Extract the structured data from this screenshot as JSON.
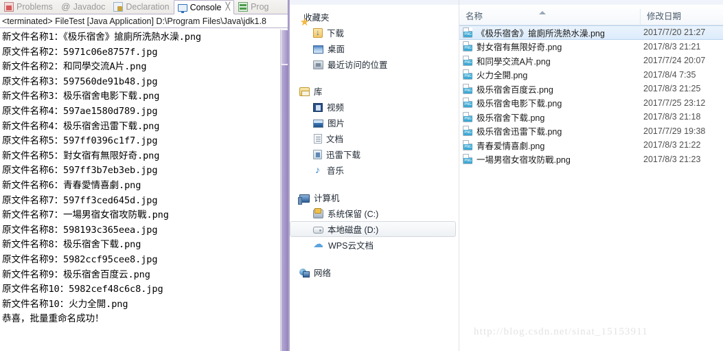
{
  "eclipse": {
    "tabs": [
      {
        "label": "Problems",
        "icon": "problems-icon",
        "active": false
      },
      {
        "label": "Javadoc",
        "icon": "javadoc-icon",
        "active": false
      },
      {
        "label": "Declaration",
        "icon": "declaration-icon",
        "active": false
      },
      {
        "label": "Console",
        "icon": "console-icon",
        "active": true,
        "close_glyph": "╳"
      },
      {
        "label": "Prog",
        "icon": "progress-icon",
        "active": false
      }
    ],
    "launch_line": "<terminated> FileTest [Java Application] D:\\Program Files\\Java\\jdk1.8",
    "console_lines": [
      "新文件名称1：《极乐宿舍》搶廁所洗熱水澡.png",
      "原文件名称2：5971c06e8757f.jpg",
      "新文件名称2：和同學交流A片.png",
      "原文件名称3：597560de91b48.jpg",
      "新文件名称3：极乐宿舍电影下载.png",
      "原文件名称4：597ae1580d789.jpg",
      "新文件名称4：极乐宿舍迅雷下载.png",
      "原文件名称5：597ff0396c1f7.jpg",
      "新文件名称5：對女宿有無限好奇.png",
      "原文件名称6：597ff3b7eb3eb.jpg",
      "新文件名称6：青春愛情喜劇.png",
      "原文件名称7：597ff3ced645d.jpg",
      "新文件名称7：一場男宿女宿攻防戰.png",
      "原文件名称8：598193c365eea.jpg",
      "新文件名称8：极乐宿舍下载.png",
      "原文件名称9：5982ccf95cee8.jpg",
      "新文件名称9：极乐宿舍百度云.png",
      "原文件名称10：5982cef48c6c8.jpg",
      "新文件名称10：火力全開.png",
      "恭喜，批量重命名成功！"
    ]
  },
  "explorer": {
    "nav": {
      "groups": [
        {
          "root": {
            "label": "收藏夹",
            "icon": "favorites-star-icon"
          },
          "items": [
            {
              "label": "下载",
              "icon": "downloads-icon"
            },
            {
              "label": "桌面",
              "icon": "desktop-icon"
            },
            {
              "label": "最近访问的位置",
              "icon": "recent-places-icon"
            }
          ]
        },
        {
          "root": {
            "label": "库",
            "icon": "library-icon"
          },
          "items": [
            {
              "label": "视频",
              "icon": "video-icon"
            },
            {
              "label": "图片",
              "icon": "pictures-icon"
            },
            {
              "label": "文档",
              "icon": "documents-icon"
            },
            {
              "label": "迅雷下载",
              "icon": "thunder-download-icon"
            },
            {
              "label": "音乐",
              "icon": "music-icon"
            }
          ]
        },
        {
          "root": {
            "label": "计算机",
            "icon": "computer-icon"
          },
          "items": [
            {
              "label": "系统保留 (C:)",
              "icon": "system-drive-icon",
              "selected": false
            },
            {
              "label": "本地磁盘 (D:)",
              "icon": "local-drive-icon",
              "selected": true
            },
            {
              "label": "WPS云文档",
              "icon": "cloud-icon",
              "selected": false
            }
          ]
        },
        {
          "root": {
            "label": "网络",
            "icon": "network-icon"
          },
          "items": []
        }
      ]
    },
    "columns": {
      "name": "名称",
      "date": "修改日期",
      "sort": "ascending"
    },
    "files": [
      {
        "name": "《极乐宿舍》搶廁所洗熱水澡.png",
        "date": "2017/7/20 21:27",
        "icon": "png-file-icon",
        "selected": true
      },
      {
        "name": "對女宿有無限好奇.png",
        "date": "2017/8/3 21:21",
        "icon": "png-file-icon",
        "selected": false
      },
      {
        "name": "和同學交流A片.png",
        "date": "2017/7/24 20:07",
        "icon": "png-file-icon",
        "selected": false
      },
      {
        "name": "火力全開.png",
        "date": "2017/8/4 7:35",
        "icon": "png-file-icon",
        "selected": false
      },
      {
        "name": "极乐宿舍百度云.png",
        "date": "2017/8/3 21:25",
        "icon": "png-file-icon",
        "selected": false
      },
      {
        "name": "极乐宿舍电影下载.png",
        "date": "2017/7/25 23:12",
        "icon": "png-file-icon",
        "selected": false
      },
      {
        "name": "极乐宿舍下载.png",
        "date": "2017/8/3 21:18",
        "icon": "png-file-icon",
        "selected": false
      },
      {
        "name": "极乐宿舍迅雷下载.png",
        "date": "2017/7/29 19:38",
        "icon": "png-file-icon",
        "selected": false
      },
      {
        "name": "青春爱情喜劇.png",
        "date": "2017/8/3 21:22",
        "icon": "png-file-icon",
        "selected": false
      },
      {
        "name": "一場男宿女宿攻防戰.png",
        "date": "2017/8/3 21:23",
        "icon": "png-file-icon",
        "selected": false
      }
    ],
    "watermark": "http://blog.csdn.net/sinat_15153911"
  },
  "colors": {
    "selection_blue": "#dcebfb",
    "selection_border": "#b9d4ef",
    "png_badge": "#3fa9d4",
    "scrollbar_thumb": "#a293c6",
    "watermark": "#e3e3e3"
  }
}
